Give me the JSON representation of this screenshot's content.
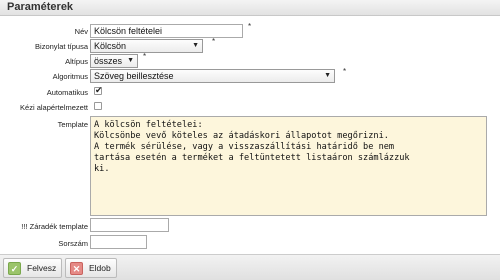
{
  "header": {
    "title": "Paraméterek"
  },
  "form": {
    "nev": {
      "label": "Név",
      "value": "Kölcsön feltételei",
      "required": "*"
    },
    "bizonylat_tipusa": {
      "label": "Bizonylat típusa",
      "value": "Kölcsön",
      "required": "*"
    },
    "altipus": {
      "label": "Altípus",
      "value": "összes",
      "required": "*"
    },
    "algoritmus": {
      "label": "Algoritmus",
      "value": "Szöveg beillesztése",
      "required": "*"
    },
    "automatikus": {
      "label": "Automatikus",
      "checked": true
    },
    "kezi_alapertelmezett": {
      "label": "Kézi alapértelmezett",
      "checked": false
    },
    "template": {
      "label": "Template",
      "value": "A kölcsön feltételei:\nKölcsönbe vevő köteles az átadáskori állapotot megőrizni.\nA termék sérülése, vagy a visszaszállítási határidő be nem\ntartása esetén a terméket a feltüntetett listaáron számlázzuk\nki."
    },
    "zaradek_template": {
      "label": "!!! Záradék template",
      "value": ""
    },
    "sorszam": {
      "label": "Sorszám",
      "value": ""
    }
  },
  "footer": {
    "save_label": "Felvesz",
    "delete_label": "Eldob"
  },
  "icons": {
    "save": "check-icon",
    "delete": "x-icon",
    "dropdown": "chevron-down-icon"
  }
}
